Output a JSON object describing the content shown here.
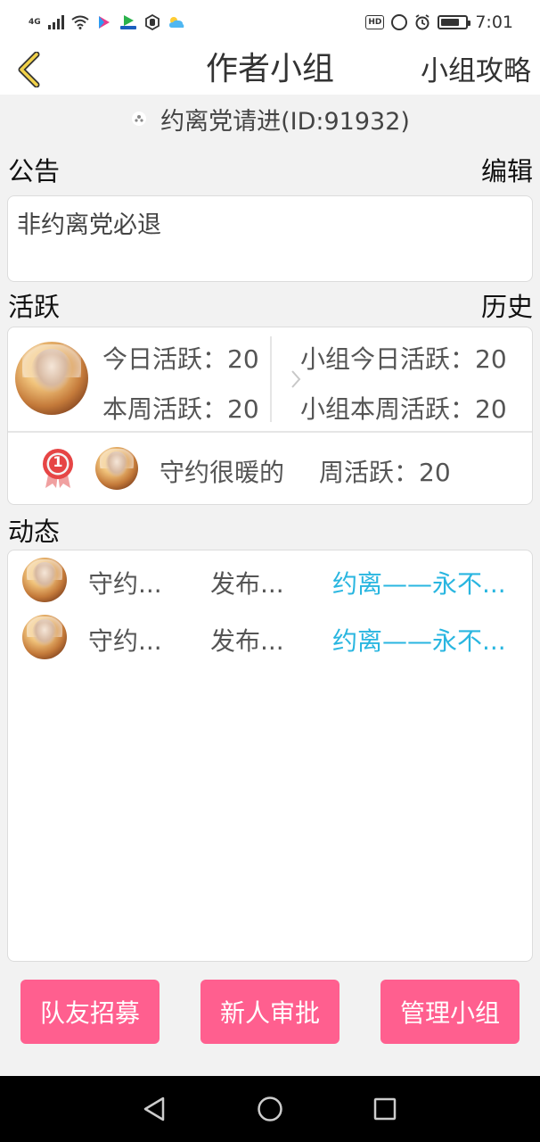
{
  "status_bar": {
    "network": "4G",
    "time": "7:01",
    "hd_badge": "HD"
  },
  "nav": {
    "title": "作者小组",
    "right_action": "小组攻略"
  },
  "group": {
    "name_id": "约离党请进(ID:91932)"
  },
  "notice": {
    "header": "公告",
    "edit": "编辑",
    "text": "非约离党必退"
  },
  "activity": {
    "header": "活跃",
    "history": "历史",
    "today": "今日活跃：20",
    "week": "本周活跃：20",
    "group_today": "小组今日活跃：20",
    "group_week": "小组本周活跃：20",
    "rank": "1",
    "top_member": "守约很暖的",
    "top_member_score": "周活跃：20"
  },
  "feed": {
    "header": "动态",
    "items": [
      {
        "user": "守约...",
        "action": "发布...",
        "target": "约离——永不..."
      },
      {
        "user": "守约...",
        "action": "发布...",
        "target": "约离——永不..."
      }
    ]
  },
  "buttons": {
    "recruit": "队友招募",
    "approve": "新人审批",
    "manage": "管理小组"
  },
  "colors": {
    "accent": "#ff5f8f",
    "link": "#29b6e0",
    "medal": "#e64545"
  }
}
